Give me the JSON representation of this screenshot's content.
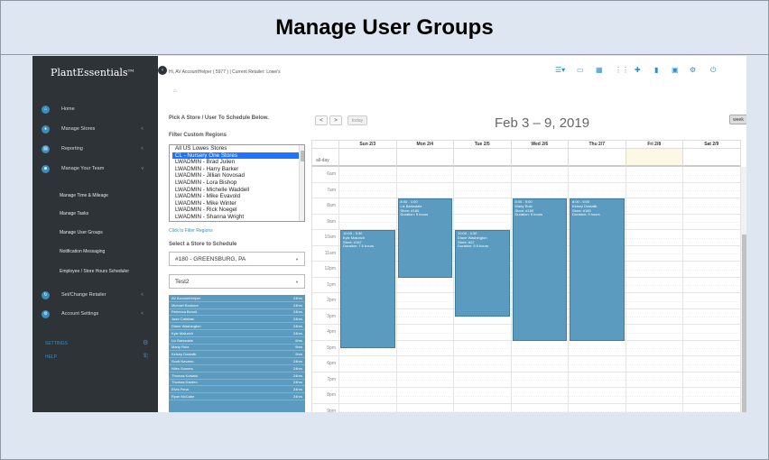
{
  "banner": {
    "title": "Manage User Groups"
  },
  "brand": {
    "name_part1": "Plant",
    "name_part2": "Essentials",
    "tm": "TM"
  },
  "sidebar": {
    "items": [
      {
        "label": "Home",
        "icon": "home-icon"
      },
      {
        "label": "Manage Stores",
        "icon": "location-pin-icon"
      },
      {
        "label": "Reporting",
        "icon": "chart-icon"
      },
      {
        "label": "Manage Your Team",
        "icon": "team-icon"
      }
    ],
    "sub_items": [
      "Manage Time & Mileage",
      "Manage Tasks",
      "Manage User Groups",
      "Notification Messaging",
      "Employee / Store Hours Scheduler"
    ],
    "bottom_items": [
      {
        "label": "Set/Change Retailer",
        "icon": "refresh-icon"
      },
      {
        "label": "Account Settings",
        "icon": "gears-icon"
      }
    ],
    "settings_label": "SETTINGS",
    "help_label": "HELP"
  },
  "header": {
    "greeting": "Hi, AV AccountHelper ( 5977 )   |   Current Retailer: Lowe's"
  },
  "left_panel": {
    "pick_label": "Pick A Store / User To Schedule Below.",
    "filter_label": "Filter Custom Regions",
    "regions": [
      "All US Lowes Stores",
      "CL - Nursery One Stores",
      "LWADMIN - Brad Julien",
      "LWADMIN - Harry Barker",
      "LWADMIN - Jillian Novosad",
      "LWADMIN - Lora Bishop",
      "LWADMIN - Michelle Waddell",
      "LWADMIN - Mike Evavold",
      "LWADMIN - Mike Winter",
      "LWADMIN - Rick Noegel",
      "LWADMIN - Shanna Wright"
    ],
    "selected_region_index": 1,
    "filter_link": "Click to Filter Regions",
    "store_label": "Select a Store to Schedule",
    "store_value": "#180 - GREENSBURG, PA",
    "group_value": "Test2",
    "users": [
      {
        "name": "AV AccountHelper",
        "hrs": "24hrs"
      },
      {
        "name": "Michael Bookout",
        "hrs": "24hrs"
      },
      {
        "name": "Rebecca Benoit",
        "hrs": "24hrs"
      },
      {
        "name": "Jose Callahan",
        "hrs": "24hrs"
      },
      {
        "name": "Diane Washington",
        "hrs": "24hrs"
      },
      {
        "name": "Kyle Malurich",
        "hrs": "24hrs"
      },
      {
        "name": "Liz Barksdale",
        "hrs": "6hrs"
      },
      {
        "name": "Marty Rutz",
        "hrs": "9hrs"
      },
      {
        "name": "Kelsey Dostalik",
        "hrs": "9hrs"
      },
      {
        "name": "Scott Navarro",
        "hrs": "24hrs"
      },
      {
        "name": "Niles Sumers",
        "hrs": "24hrs"
      },
      {
        "name": "Thomas Kotwick",
        "hrs": "24hrs"
      },
      {
        "name": "Thomas Darden",
        "hrs": "24hrs"
      },
      {
        "name": "Elvis Pena",
        "hrs": "24hrs"
      },
      {
        "name": "Ryan McCabe",
        "hrs": "24hrs"
      }
    ]
  },
  "calendar": {
    "title": "Feb 3 – 9, 2019",
    "today_label": "today",
    "week_label": "week",
    "prev_label": "<",
    "next_label": ">",
    "allday_label": "all-day",
    "days": [
      "Sun 2/3",
      "Mon 2/4",
      "Tue 2/5",
      "Wed 2/6",
      "Thu 2/7",
      "Fri 2/8",
      "Sat 2/9"
    ],
    "today_index": 5,
    "hours": [
      "6am",
      "7am",
      "8am",
      "9am",
      "10am",
      "11am",
      "12pm",
      "1pm",
      "2pm",
      "3pm",
      "4pm",
      "5pm",
      "6pm",
      "7pm",
      "8pm",
      "9pm"
    ],
    "events": [
      {
        "day": 0,
        "start": 10,
        "end": 17.5,
        "time": "10:00 - 5:30",
        "name": "Kyle Malurich",
        "store": "Store: #187",
        "duration": "Duration: 7.5 hours"
      },
      {
        "day": 1,
        "start": 8,
        "end": 13,
        "time": "8:00 - 1:00",
        "name": "Liz Barksdale",
        "store": "Store: #180",
        "duration": "Duration: 5 hours"
      },
      {
        "day": 2,
        "start": 10,
        "end": 15.5,
        "time": "10:00 - 3:30",
        "name": "Diane Washington",
        "store": "Store: #22",
        "duration": "Duration: 5.5 hours"
      },
      {
        "day": 3,
        "start": 8,
        "end": 17,
        "time": "8:00 - 5:00",
        "name": "Marty Rutz",
        "store": "Store: #180",
        "duration": "Duration: 9 hours"
      },
      {
        "day": 4,
        "start": 8,
        "end": 17,
        "time": "8:00 - 5:00",
        "name": "Kelsey Dostalik",
        "store": "Store: #180",
        "duration": "Duration: 9 hours"
      }
    ]
  },
  "colors": {
    "accent": "#2a8fc9",
    "event": "#5b9bbf",
    "sidebar": "#2e3338",
    "today": "#fcf8e3"
  }
}
